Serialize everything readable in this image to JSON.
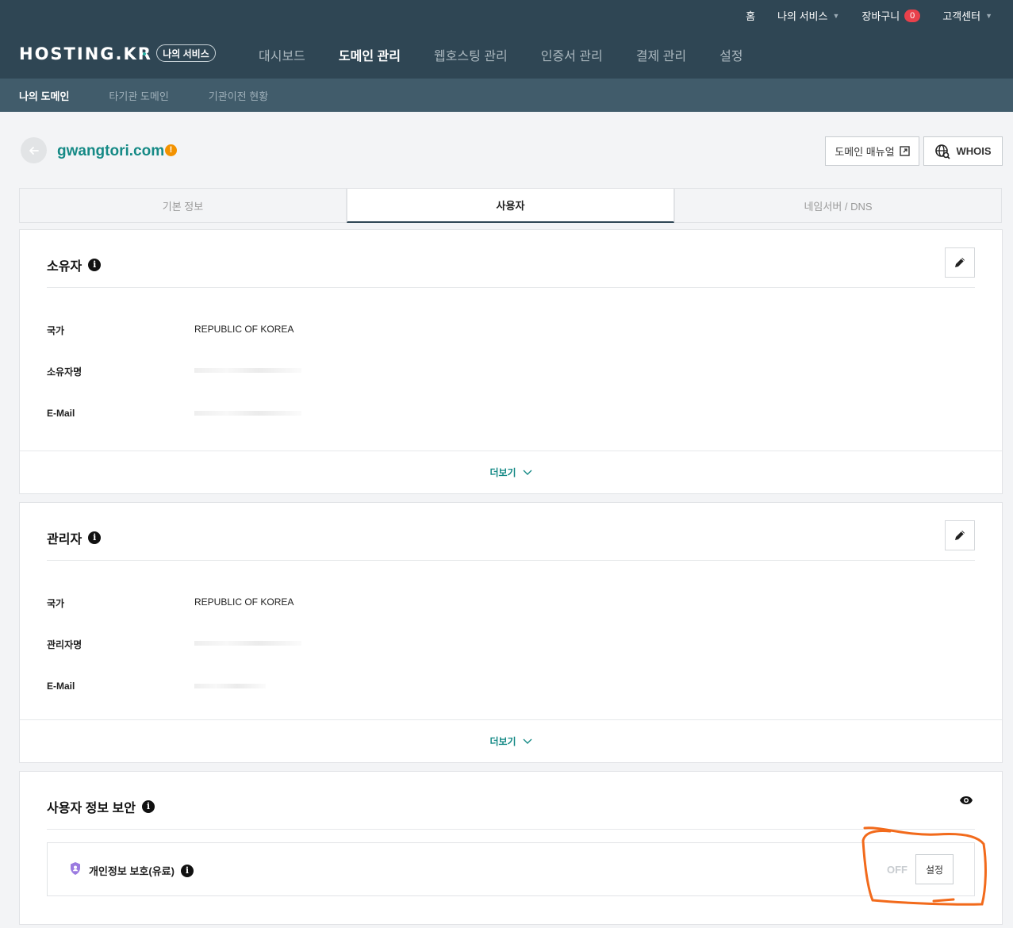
{
  "util_nav": {
    "home": "홈",
    "my_services": "나의 서비스",
    "cart": "장바구니",
    "cart_count": "0",
    "support": "고객센터"
  },
  "brand": {
    "logo": "HOSTING.KR",
    "pill": "나의 서비스"
  },
  "main_nav": [
    {
      "label": "대시보드"
    },
    {
      "label": "도메인 관리"
    },
    {
      "label": "웹호스팅 관리"
    },
    {
      "label": "인증서 관리"
    },
    {
      "label": "결제 관리"
    },
    {
      "label": "설정"
    }
  ],
  "sub_nav": [
    {
      "label": "나의 도메인"
    },
    {
      "label": "타기관 도메인"
    },
    {
      "label": "기관이전 현황"
    }
  ],
  "domain": {
    "name": "gwangtori.com",
    "manual_button": "도메인 매뉴얼",
    "whois_button": "WHOIS"
  },
  "tabs": [
    {
      "label": "기본 정보"
    },
    {
      "label": "사용자"
    },
    {
      "label": "네임서버 / DNS"
    }
  ],
  "owner": {
    "title": "소유자",
    "country_label": "국가",
    "country_value": "REPUBLIC OF KOREA",
    "name_label": "소유자명",
    "email_label": "E-Mail",
    "more": "더보기"
  },
  "admin": {
    "title": "관리자",
    "country_label": "국가",
    "country_value": "REPUBLIC OF KOREA",
    "name_label": "관리자명",
    "email_label": "E-Mail",
    "more": "더보기"
  },
  "security": {
    "title": "사용자 정보 보안",
    "privacy_label": "개인정보 보호(유료)",
    "status": "OFF",
    "set_button": "설정"
  },
  "colors": {
    "header_bg": "#2f4654",
    "subnav_bg": "#415c6b",
    "accent": "#168a86",
    "warn": "#f39200",
    "badge": "#e8414b",
    "annotation": "#f26a1b"
  }
}
